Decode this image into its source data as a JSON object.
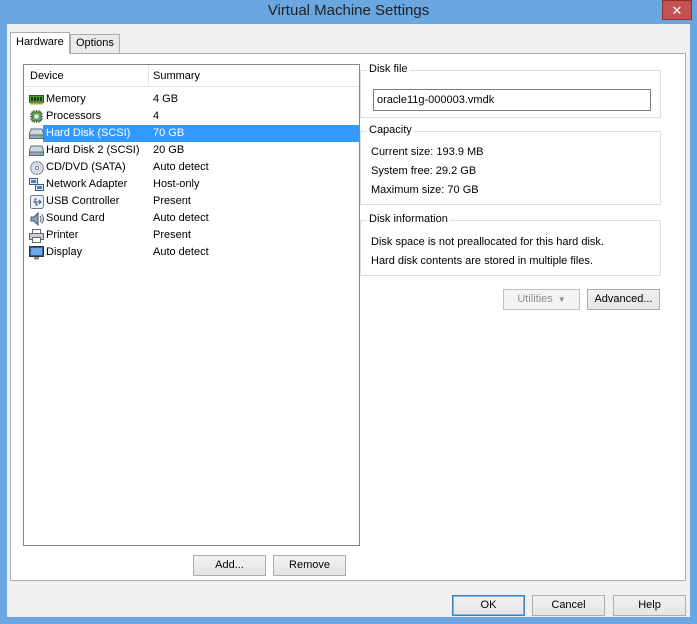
{
  "window": {
    "title": "Virtual Machine Settings",
    "close_label": "✕"
  },
  "tabs": [
    {
      "label": "Hardware",
      "active": true
    },
    {
      "label": "Options",
      "active": false
    }
  ],
  "device_list": {
    "columns": {
      "device": "Device",
      "summary": "Summary"
    },
    "rows": [
      {
        "device": "Memory",
        "summary": "4 GB",
        "icon": "memory-icon"
      },
      {
        "device": "Processors",
        "summary": "4",
        "icon": "processor-icon"
      },
      {
        "device": "Hard Disk (SCSI)",
        "summary": "70 GB",
        "icon": "hard-disk-icon",
        "selected": true
      },
      {
        "device": "Hard Disk 2 (SCSI)",
        "summary": "20 GB",
        "icon": "hard-disk-icon"
      },
      {
        "device": "CD/DVD (SATA)",
        "summary": "Auto detect",
        "icon": "cd-dvd-icon"
      },
      {
        "device": "Network Adapter",
        "summary": "Host-only",
        "icon": "network-adapter-icon"
      },
      {
        "device": "USB Controller",
        "summary": "Present",
        "icon": "usb-icon"
      },
      {
        "device": "Sound Card",
        "summary": "Auto detect",
        "icon": "sound-card-icon"
      },
      {
        "device": "Printer",
        "summary": "Present",
        "icon": "printer-icon"
      },
      {
        "device": "Display",
        "summary": "Auto detect",
        "icon": "display-icon"
      }
    ],
    "add_label": "Add...",
    "remove_label": "Remove"
  },
  "disk_file": {
    "title": "Disk file",
    "value": "oracle11g-000003.vmdk"
  },
  "capacity": {
    "title": "Capacity",
    "current_size": "Current size:  193.9 MB",
    "system_free": "System free:  29.2 GB",
    "maximum_size": "Maximum size:  70 GB"
  },
  "disk_information": {
    "title": "Disk information",
    "line1": "Disk space is not preallocated for this hard disk.",
    "line2": "Hard disk contents are stored in multiple files."
  },
  "utilities_label": "Utilities",
  "advanced_label": "Advanced...",
  "footer": {
    "ok_label": "OK",
    "cancel_label": "Cancel",
    "help_label": "Help"
  }
}
